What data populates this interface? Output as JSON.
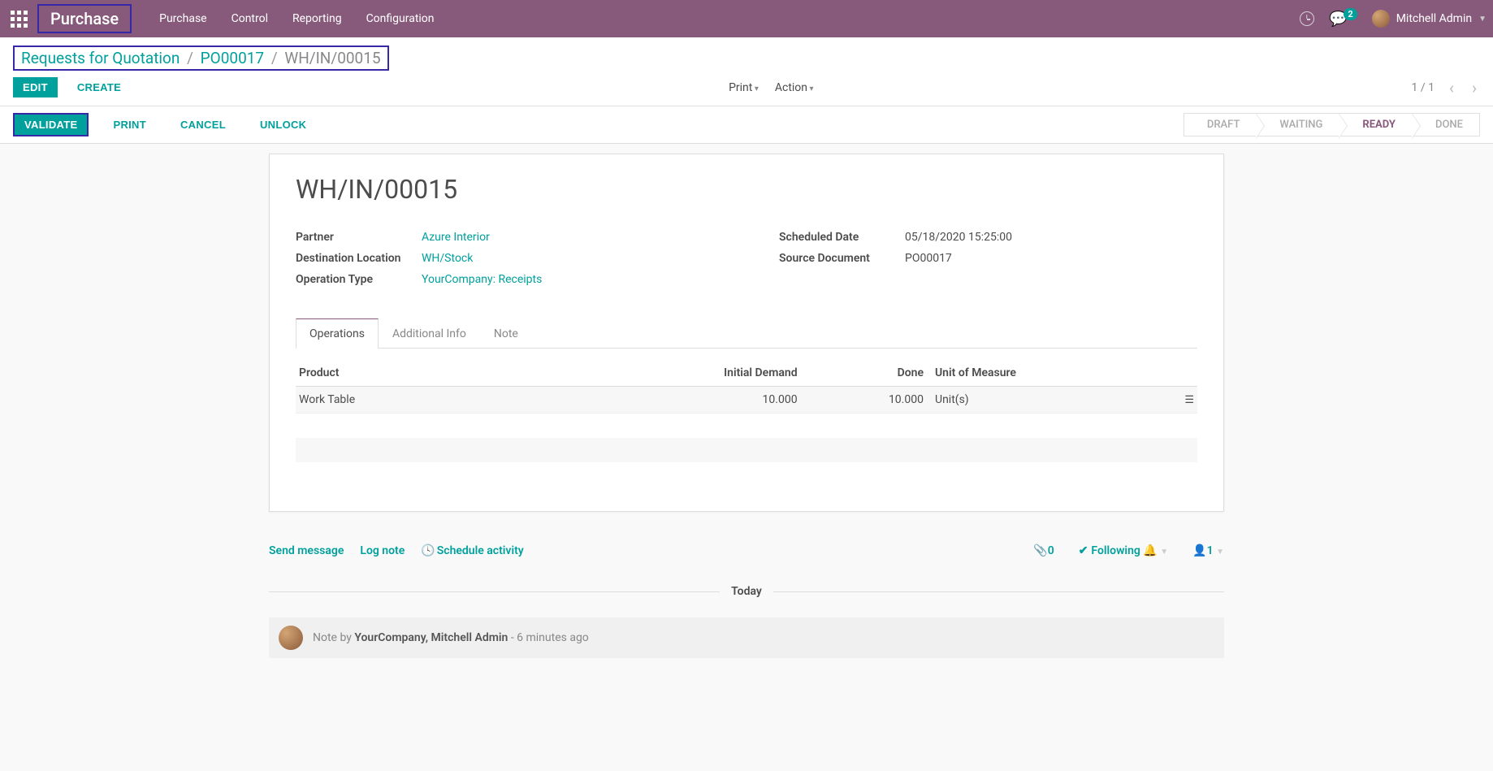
{
  "topbar": {
    "brand": "Purchase",
    "nav": [
      "Purchase",
      "Control",
      "Reporting",
      "Configuration"
    ],
    "chat_badge": "2",
    "user": "Mitchell Admin"
  },
  "breadcrumb": {
    "root": "Requests for Quotation",
    "po": "PO00017",
    "current": "WH/IN/00015"
  },
  "cp": {
    "edit": "EDIT",
    "create": "CREATE",
    "print": "Print",
    "action": "Action",
    "pager": "1 / 1"
  },
  "statusbar": {
    "validate": "VALIDATE",
    "print": "PRINT",
    "cancel": "CANCEL",
    "unlock": "UNLOCK",
    "steps": [
      "DRAFT",
      "WAITING",
      "READY",
      "DONE"
    ]
  },
  "doc": {
    "title": "WH/IN/00015",
    "fields_left": {
      "partner_label": "Partner",
      "partner_value": "Azure Interior",
      "dest_label": "Destination Location",
      "dest_value": "WH/Stock",
      "optype_label": "Operation Type",
      "optype_value": "YourCompany: Receipts"
    },
    "fields_right": {
      "sched_label": "Scheduled Date",
      "sched_value": "05/18/2020 15:25:00",
      "source_label": "Source Document",
      "source_value": "PO00017"
    },
    "tabs": [
      "Operations",
      "Additional Info",
      "Note"
    ],
    "table": {
      "headers": {
        "product": "Product",
        "demand": "Initial Demand",
        "done": "Done",
        "uom": "Unit of Measure"
      },
      "rows": [
        {
          "product": "Work Table",
          "demand": "10.000",
          "done": "10.000",
          "uom": "Unit(s)"
        }
      ]
    }
  },
  "chatter": {
    "send": "Send message",
    "log": "Log note",
    "schedule": "Schedule activity",
    "attach_count": "0",
    "following": "Following",
    "followers_count": "1",
    "today": "Today",
    "note_prefix": "Note by ",
    "note_author": "YourCompany, Mitchell Admin",
    "note_time": " - 6 minutes ago"
  }
}
